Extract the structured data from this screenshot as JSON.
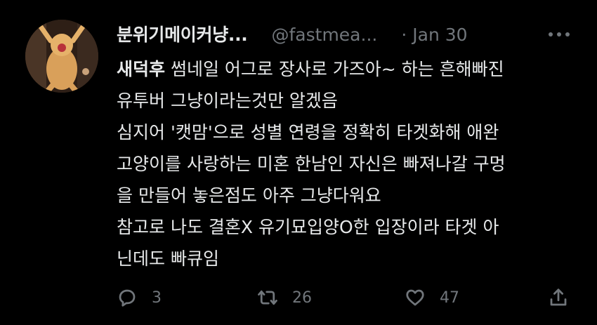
{
  "tweet": {
    "author": {
      "display_name": "분위기메이커냥...",
      "handle": "@fastmea...",
      "separator": "·",
      "date": "Jan 30"
    },
    "body": {
      "lines": [
        {
          "bold": "새덕후",
          "text": " 썸네일 어그로 장사로 가즈아~ 하는 흔해빠진"
        },
        {
          "bold": "",
          "text": "유투버 그냥이라는것만 알겠음"
        },
        {
          "bold": "",
          "text": "심지어 '캣맘'으로 성별 연령을 정확히 타겟화해 애완"
        },
        {
          "bold": "",
          "text": "고양이를 사랑하는 미혼 한남인 자신은 빠져나갈 구멍"
        },
        {
          "bold": "",
          "text": "을 만들어 놓은점도 아주 그냥다워요"
        },
        {
          "bold": "",
          "text": "참고로 나도 결혼X 유기묘입양O한 입장이라 타겟 아"
        },
        {
          "bold": "",
          "text": "닌데도 빠큐임"
        }
      ]
    },
    "actions": {
      "reply_count": "3",
      "retweet_count": "26",
      "like_count": "47"
    },
    "icons": {
      "reply": "reply-icon",
      "retweet": "retweet-icon",
      "like": "heart-icon",
      "share": "share-icon",
      "more": "more-icon"
    }
  },
  "colors": {
    "background": "#000000",
    "text_primary": "#e7e9ea",
    "text_secondary": "#71767b"
  }
}
